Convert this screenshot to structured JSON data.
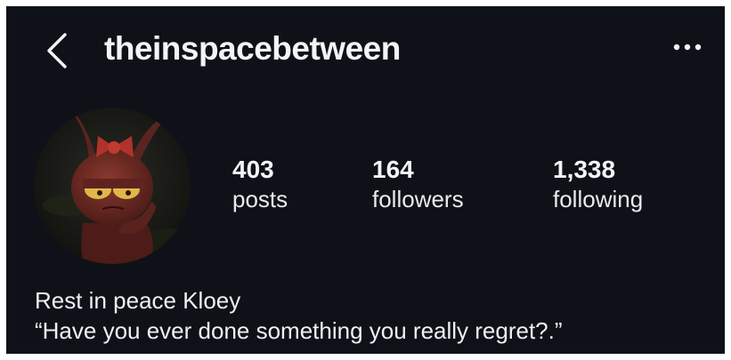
{
  "header": {
    "back_icon": "chevron-left-icon",
    "username": "theinspacebetween",
    "more_icon": "more-horizontal-icon"
  },
  "profile": {
    "avatar": "character-avatar",
    "stats": [
      {
        "value": "403",
        "label": "posts"
      },
      {
        "value": "164",
        "label": "followers"
      },
      {
        "value": "1,338",
        "label": "following"
      }
    ]
  },
  "bio": {
    "line1": "Rest in peace Kloey",
    "line2": "“Have you ever done something you really regret?.”"
  },
  "colors": {
    "background": "#0e1218",
    "text": "#f3f4f6",
    "frame": "#ffffff"
  }
}
